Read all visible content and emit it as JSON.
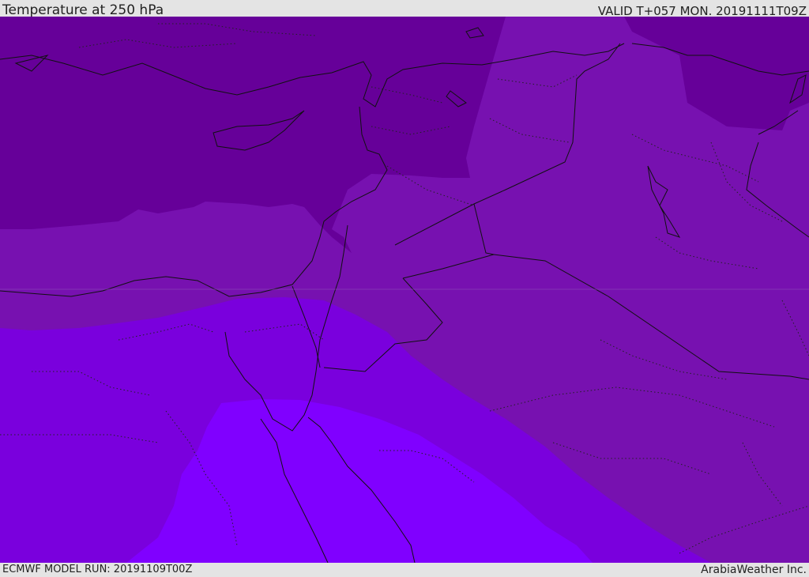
{
  "header": {
    "title": "Temperature at 250 hPa",
    "valid": "VALID T+057 MON. 20191111T09Z"
  },
  "footer": {
    "model_run": "ECMWF MODEL RUN: 20191109T00Z",
    "credit": "ArabiaWeather Inc."
  },
  "map": {
    "field": "temperature",
    "level": "250 hPa",
    "band_colors": [
      "#660099",
      "#7711b0",
      "#7a00dd",
      "#8000ff"
    ]
  }
}
